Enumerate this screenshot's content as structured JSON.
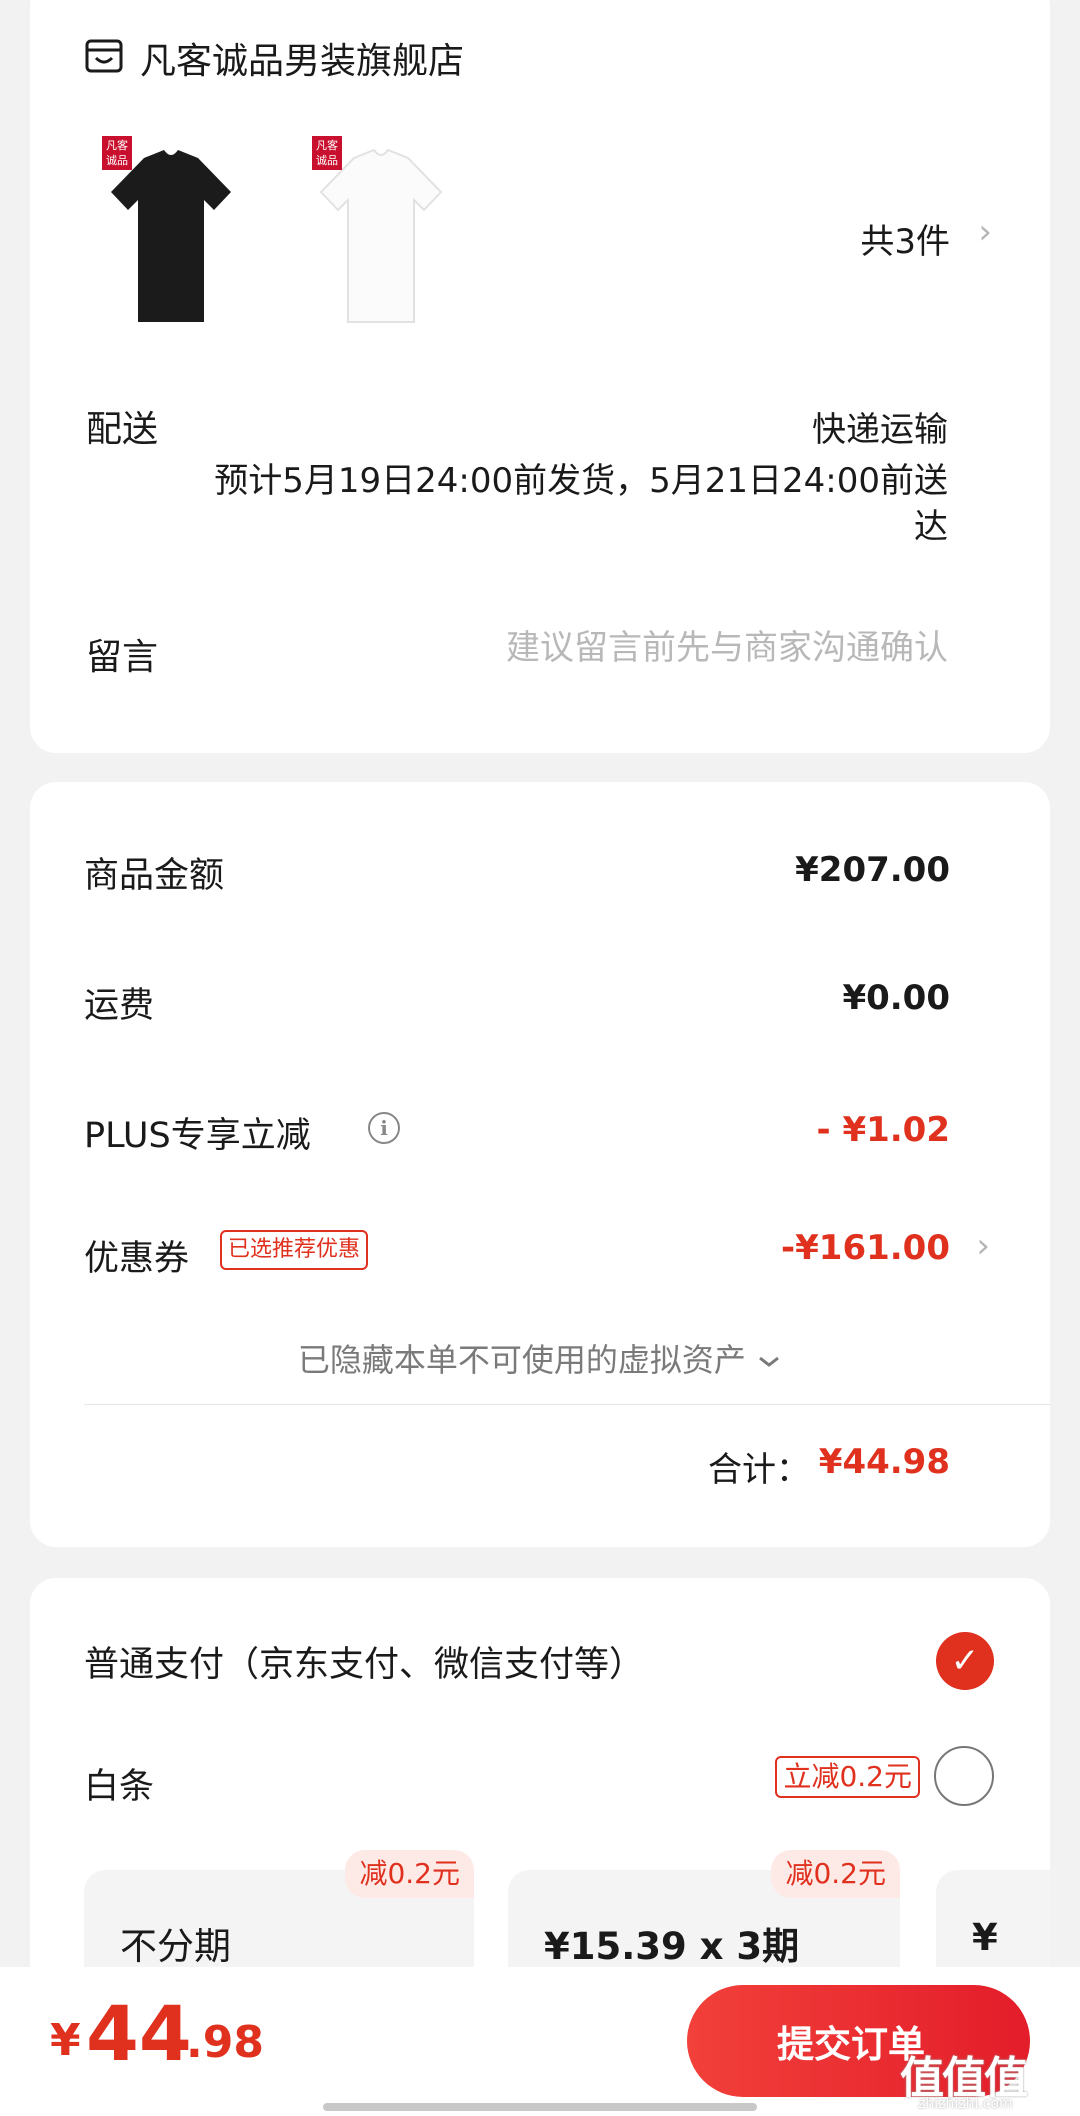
{
  "store": {
    "name": "凡客诚品男装旗舰店",
    "brand_badge": "凡客诚品",
    "products": [
      "black-tshirt",
      "white-tshirt"
    ],
    "item_count": "共3件"
  },
  "delivery": {
    "label": "配送",
    "method": "快递运输",
    "estimate": "预计5月19日24:00前发货，5月21日24:00前送达"
  },
  "message": {
    "label": "留言",
    "placeholder": "建议留言前先与商家沟通确认"
  },
  "amounts": {
    "goods_label": "商品金额",
    "goods_value": "¥207.00",
    "shipping_label": "运费",
    "shipping_value": "¥0.00",
    "plus_label": "PLUS专享立减",
    "plus_value": "- ¥1.02",
    "coupon_label": "优惠券",
    "coupon_tag": "已选推荐优惠",
    "coupon_value": "-¥161.00",
    "hidden_assets": "已隐藏本单不可使用的虚拟资产",
    "total_label": "合计：",
    "total_value": "¥44.98"
  },
  "payment": {
    "normal_label": "普通支付（京东支付、微信支付等）",
    "baitiao_label": "白条",
    "baitiao_promo": "立减0.2元",
    "plans": [
      {
        "tag": "减0.2元",
        "title": "不分期"
      },
      {
        "tag": "减0.2元",
        "title": "¥15.39 x 3期"
      },
      {
        "title": "¥"
      }
    ]
  },
  "bottom": {
    "price_symbol": "¥",
    "price_integer": "44",
    "price_decimal": ".98",
    "submit_label": "提交订单"
  },
  "watermark": {
    "glyph": "值值值",
    "url": "zhizhizhi.com"
  },
  "colors": {
    "accent_red": "#e0301e",
    "brand_badge_red": "#c8102e",
    "background": "#f2f2f2"
  }
}
